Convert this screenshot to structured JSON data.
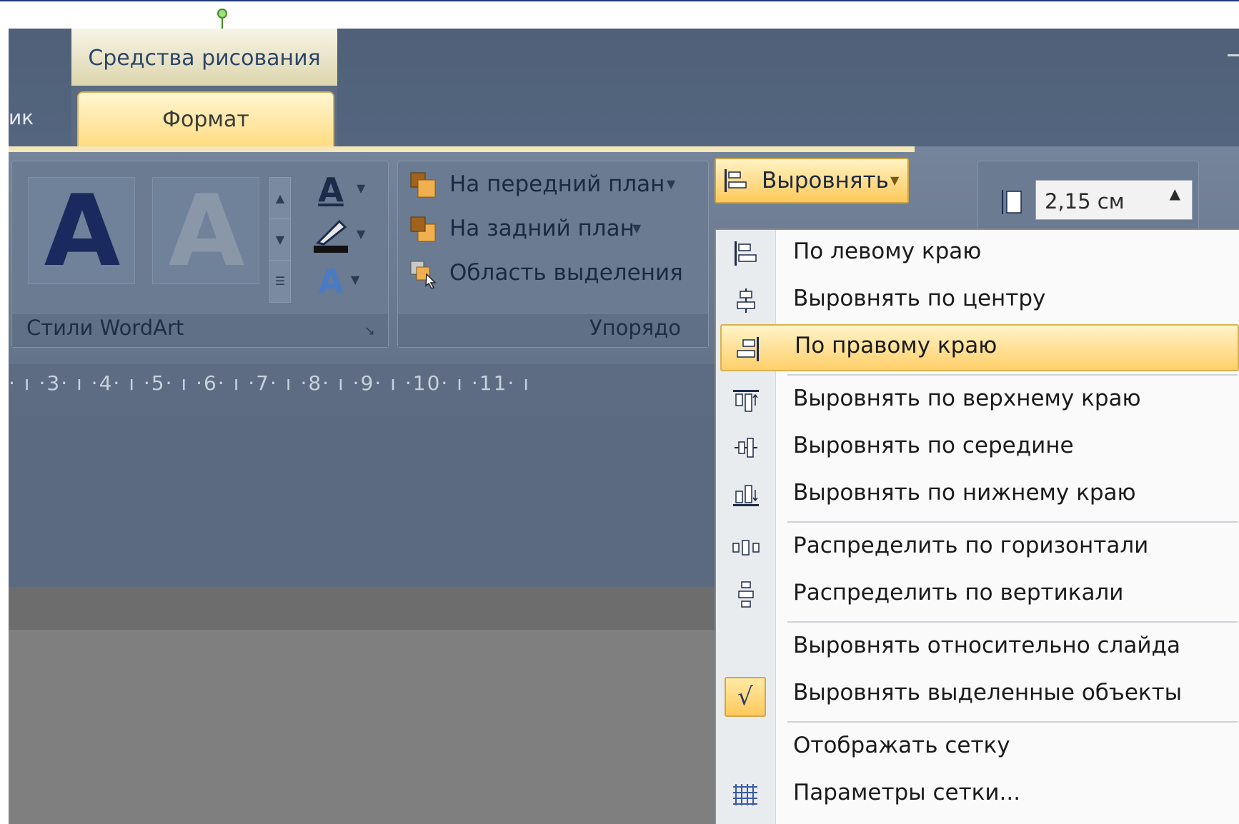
{
  "contextual_header": {
    "label": "Средства рисования"
  },
  "tabs": {
    "partial_left": "ик",
    "active": "Формат"
  },
  "wordart_group": {
    "label": "Стили WordArt",
    "sample_a": "A"
  },
  "arrange_group": {
    "label": "Упорядо",
    "bring_forward": "На передний план",
    "send_backward": "На задний план",
    "selection_pane": "Область выделения"
  },
  "align_button": {
    "label": "Выровнять"
  },
  "size_group": {
    "height_value": "2,15 см"
  },
  "ruler": {
    "text": "· ı ·3· ı ·4· ı ·5· ı ·6· ı ·7· ı ·8· ı ·9· ı ·10· ı ·11· ı"
  },
  "align_menu": {
    "items": [
      {
        "label": "По левому краю",
        "icon": "align-left-icon",
        "highlighted": false
      },
      {
        "label": "Выровнять по центру",
        "icon": "align-center-icon",
        "highlighted": false
      },
      {
        "label": "По правому краю",
        "icon": "align-right-icon",
        "highlighted": true
      },
      {
        "label": "Выровнять по верхнему краю",
        "icon": "align-top-icon",
        "highlighted": false
      },
      {
        "label": "Выровнять по середине",
        "icon": "align-middle-icon",
        "highlighted": false
      },
      {
        "label": "Выровнять по нижнему краю",
        "icon": "align-bottom-icon",
        "highlighted": false
      },
      {
        "label": "Распределить по горизонтали",
        "icon": "distribute-horizontal-icon",
        "highlighted": false
      },
      {
        "label": "Распределить по вертикали",
        "icon": "distribute-vertical-icon",
        "highlighted": false
      },
      {
        "label": "Выровнять относительно слайда",
        "icon": "",
        "highlighted": false
      },
      {
        "label": "Выровнять выделенные объекты",
        "icon": "checkmark-icon",
        "checked": true,
        "highlighted": false
      },
      {
        "label": "Отображать сетку",
        "icon": "",
        "highlighted": false
      },
      {
        "label": "Параметры сетки...",
        "icon": "grid-icon",
        "highlighted": false
      }
    ],
    "check_glyph": "√"
  },
  "colors": {
    "accent_highlight": "#ffcf6a",
    "ribbon": "#6b7b91",
    "menu_bg": "#fafafa"
  }
}
